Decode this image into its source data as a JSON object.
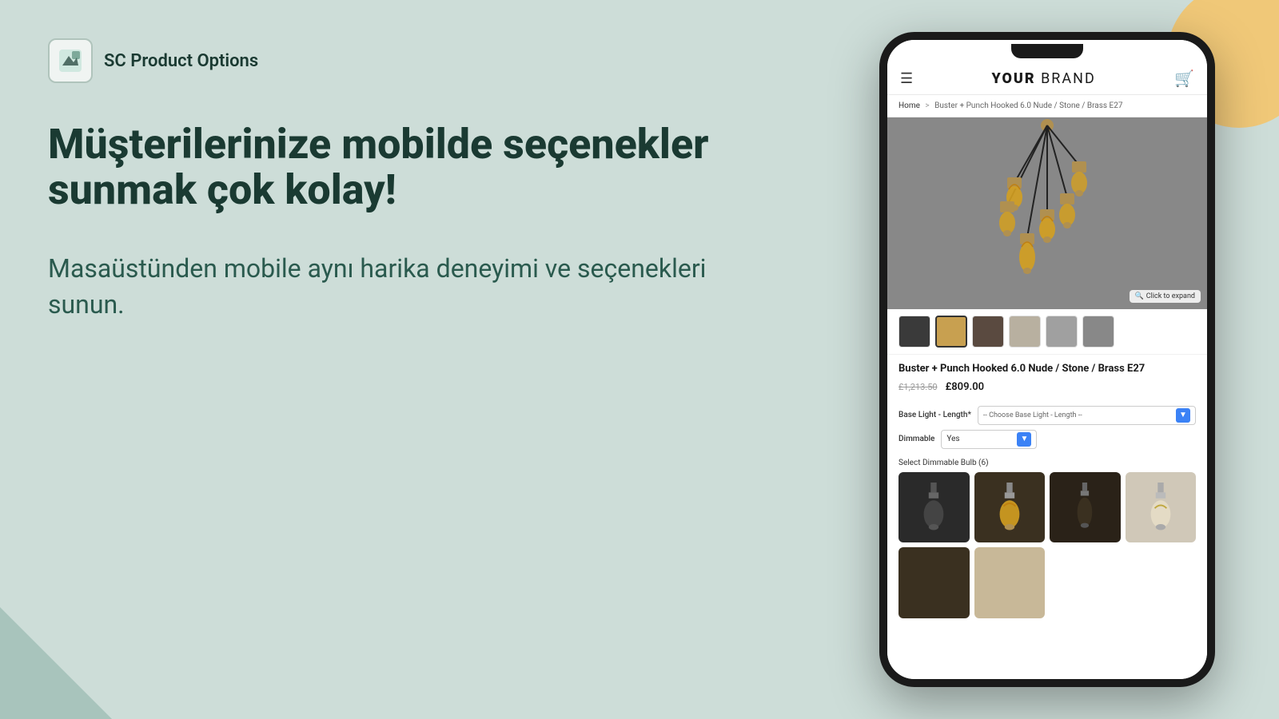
{
  "app": {
    "logo_label": "SC Product Options",
    "logo_icon": "🖼️"
  },
  "left": {
    "headline": "Müşterilerinize mobilde seçenekler sunmak çok kolay!",
    "subtext": "Masaüstünden mobile aynı harika deneyimi ve seçenekleri sunun."
  },
  "phone": {
    "brand_name_bold": "YOUR",
    "brand_name_light": " BRAND",
    "cart_icon": "🛒",
    "breadcrumb": {
      "home": "Home",
      "separator": ">",
      "path": "Buster + Punch Hooked 6.0 Nude / Stone / Brass E27"
    },
    "product": {
      "title": "Buster + Punch Hooked 6.0 Nude / Stone / Brass E27",
      "price_original": "£1,213.50",
      "price_sale": "£809.00",
      "click_expand": "Click to expand"
    },
    "options": {
      "base_light_label": "Base Light - Length*",
      "base_light_placeholder": "-- Choose Base Light - Length --",
      "dimmable_label": "Dimmable",
      "dimmable_value": "Yes",
      "dimmable_bulb_label": "Select Dimmable Bulb (6)"
    }
  }
}
